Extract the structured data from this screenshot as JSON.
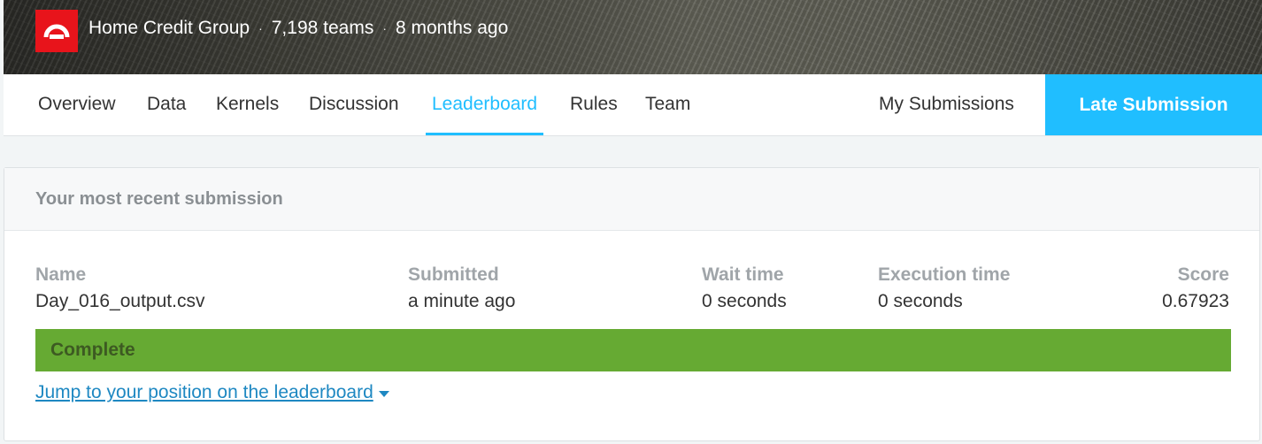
{
  "banner": {
    "organization": "Home Credit Group",
    "teams": "7,198 teams",
    "time_ago": "8 months ago",
    "logo_color": "#e8141b"
  },
  "tabs": [
    {
      "label": "Overview",
      "active": false
    },
    {
      "label": "Data",
      "active": false
    },
    {
      "label": "Kernels",
      "active": false
    },
    {
      "label": "Discussion",
      "active": false
    },
    {
      "label": "Leaderboard",
      "active": true
    },
    {
      "label": "Rules",
      "active": false
    },
    {
      "label": "Team",
      "active": false
    }
  ],
  "my_submissions_label": "My Submissions",
  "late_submission_label": "Late Submission",
  "accent_color": "#20beff",
  "submission": {
    "header": "Your most recent submission",
    "columns": {
      "name": {
        "label": "Name",
        "value": "Day_016_output.csv"
      },
      "submitted": {
        "label": "Submitted",
        "value": "a minute ago"
      },
      "wait_time": {
        "label": "Wait time",
        "value": "0 seconds"
      },
      "execution_time": {
        "label": "Execution time",
        "value": "0 seconds"
      },
      "score": {
        "label": "Score",
        "value": "0.67923"
      }
    },
    "status": "Complete",
    "status_color": "#66aa33",
    "jump_link": "Jump to your position on the leaderboard"
  }
}
